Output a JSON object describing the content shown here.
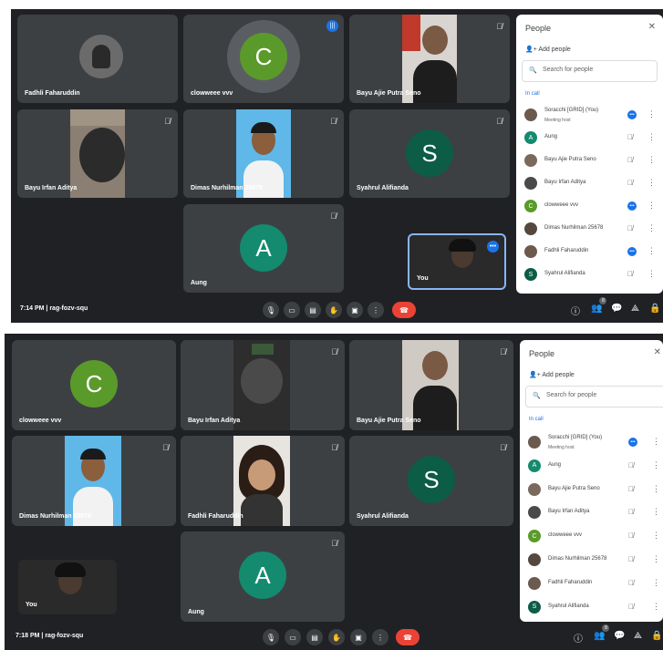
{
  "screenshots": [
    {
      "tiles": [
        {
          "name": "Fadhli Faharuddin",
          "kind": "photo-avatar",
          "muted": false
        },
        {
          "name": "clowweee vvv",
          "kind": "letter",
          "letter": "C",
          "color": "#5a9a2a",
          "speaking": true
        },
        {
          "name": "Bayu Ajie Putra Seno",
          "kind": "video",
          "muted": true
        },
        {
          "name": "Bayu Irfan Aditya",
          "kind": "video",
          "muted": true
        },
        {
          "name": "Dimas Nurhilman 25678",
          "kind": "video",
          "muted": true
        },
        {
          "name": "Syahrul Alifianda",
          "kind": "letter",
          "letter": "S",
          "color": "#0d5c45",
          "muted": true
        },
        {
          "name": "Aung",
          "kind": "letter",
          "letter": "A",
          "color": "#148a6e",
          "muted": true
        }
      ],
      "self_view": {
        "name": "You"
      },
      "bottom_bar": {
        "time": "7:14 PM",
        "meeting_code": "rag-fozv-squ",
        "people_count": "8"
      },
      "panel": {
        "title": "People",
        "add_people": "Add people",
        "search_placeholder": "Search for people",
        "section_label": "In call",
        "participants": [
          {
            "name": "Soracchi [GRID] (You)",
            "sub": "Meeting host",
            "avatar": "photo",
            "status": "speaking"
          },
          {
            "name": "Aung",
            "avatar": "A",
            "avatar_color": "#148a6e",
            "status": "muted"
          },
          {
            "name": "Bayu Ajie Putra Seno",
            "avatar": "photo",
            "status": "muted"
          },
          {
            "name": "Bayu Irfan Aditya",
            "avatar": "photo",
            "status": "muted"
          },
          {
            "name": "clowweee vvv",
            "avatar": "C",
            "avatar_color": "#5a9a2a",
            "status": "speaking"
          },
          {
            "name": "Dimas Nurhilman 25678",
            "avatar": "photo",
            "status": "muted"
          },
          {
            "name": "Fadhli Faharuddin",
            "avatar": "photo",
            "status": "speaking"
          },
          {
            "name": "Syahrul Alifianda",
            "avatar": "S",
            "avatar_color": "#0d5c45",
            "status": "muted"
          }
        ]
      }
    },
    {
      "tiles": [
        {
          "name": "clowweee vvv",
          "kind": "letter",
          "letter": "C",
          "color": "#5a9a2a",
          "muted": false
        },
        {
          "name": "Bayu Irfan Aditya",
          "kind": "video",
          "muted": true
        },
        {
          "name": "Bayu Ajie Putra Seno",
          "kind": "video",
          "muted": true
        },
        {
          "name": "Dimas Nurhilman 25678",
          "kind": "video",
          "muted": true
        },
        {
          "name": "Fadhli Faharuddin",
          "kind": "video",
          "muted": true
        },
        {
          "name": "Syahrul Alifianda",
          "kind": "letter",
          "letter": "S",
          "color": "#0d5c45",
          "muted": true
        },
        {
          "name": "Aung",
          "kind": "letter",
          "letter": "A",
          "color": "#148a6e",
          "muted": true
        }
      ],
      "self_view": {
        "name": "You"
      },
      "bottom_bar": {
        "time": "7:18 PM",
        "meeting_code": "rag-fozv-squ",
        "people_count": "8"
      },
      "panel": {
        "title": "People",
        "add_people": "Add people",
        "search_placeholder": "Search for people",
        "section_label": "In call",
        "participants": [
          {
            "name": "Soracchi [GRID] (You)",
            "sub": "Meeting host",
            "avatar": "photo",
            "status": "speaking"
          },
          {
            "name": "Aung",
            "avatar": "A",
            "avatar_color": "#148a6e",
            "status": "muted"
          },
          {
            "name": "Bayu Ajie Putra Seno",
            "avatar": "photo",
            "status": "muted"
          },
          {
            "name": "Bayu Irfan Aditya",
            "avatar": "photo",
            "status": "muted"
          },
          {
            "name": "clowweee vvv",
            "avatar": "C",
            "avatar_color": "#5a9a2a",
            "status": "muted"
          },
          {
            "name": "Dimas Nurhilman 25678",
            "avatar": "photo",
            "status": "muted"
          },
          {
            "name": "Fadhli Faharuddin",
            "avatar": "photo",
            "status": "muted"
          },
          {
            "name": "Syahrul Alifianda",
            "avatar": "S",
            "avatar_color": "#0d5c45",
            "status": "muted"
          }
        ]
      }
    }
  ],
  "icons": {
    "mic_off": "mic-off-icon",
    "mic": "mic-icon",
    "camera": "camera-icon",
    "captions": "captions-icon",
    "raise_hand": "raise-hand-icon",
    "present": "present-icon",
    "more": "more-icon",
    "end_call": "end-call-icon",
    "info": "info-icon",
    "people": "people-icon",
    "chat": "chat-icon",
    "activities": "activities-icon",
    "lock": "lock-icon",
    "search": "search-icon",
    "add_person": "add-person-icon",
    "close": "close-icon"
  },
  "colors": {
    "meeting_bg": "#202124",
    "tile_bg": "#3c4043",
    "accent": "#1a73e8",
    "end_call": "#ea4335"
  }
}
